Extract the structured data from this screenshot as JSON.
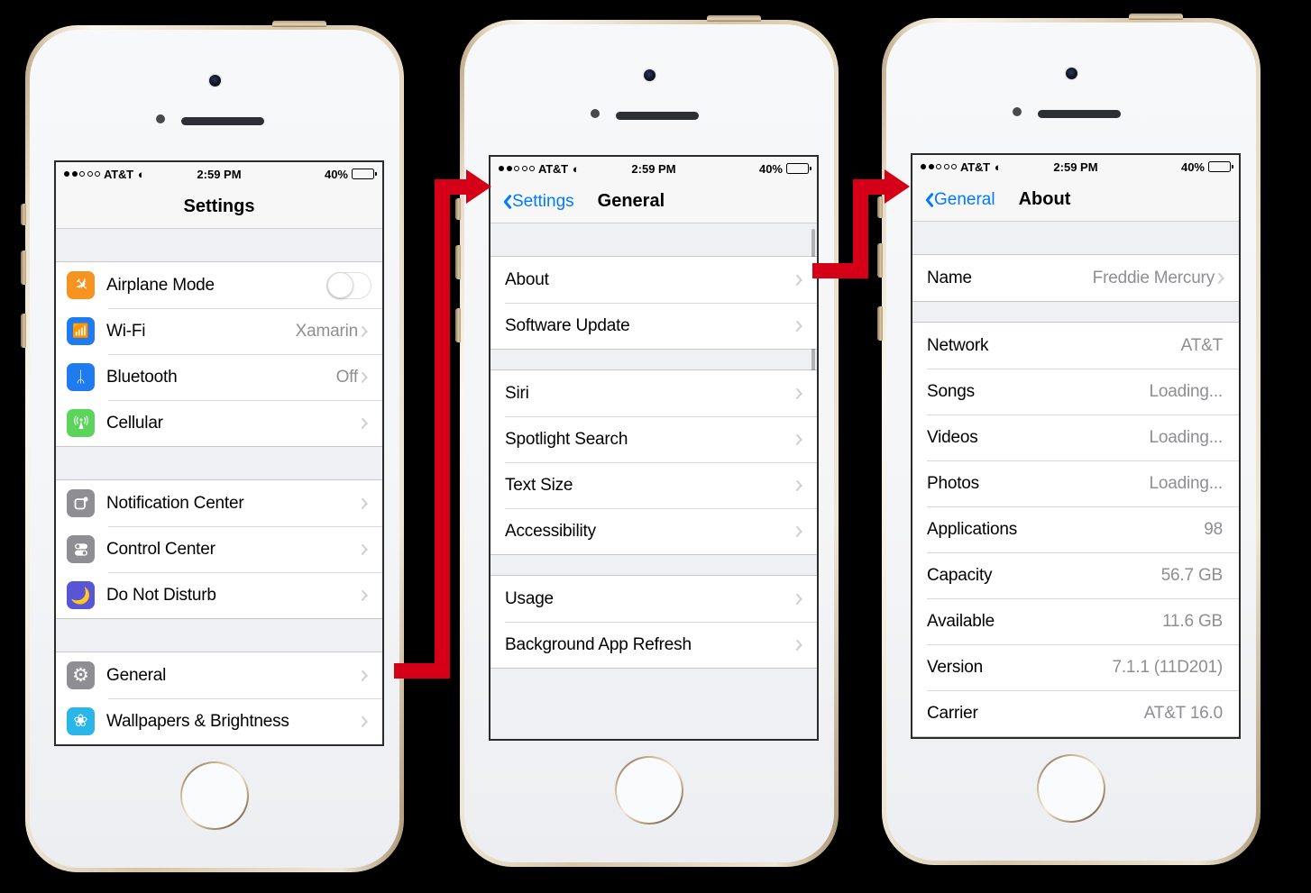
{
  "background_color": "#000000",
  "accent_color": "#007aff",
  "arrow_color": "#d50017",
  "statusbar": {
    "carrier": "AT&T",
    "time": "2:59 PM",
    "battery_percent": "40%",
    "signal_dots_filled": 2,
    "signal_dots_total": 5,
    "wifi_icon": "wifi-icon",
    "battery_icon": "battery-icon"
  },
  "phones": [
    {
      "id": "phone-settings",
      "nav": {
        "title": "Settings",
        "back_label": null,
        "centered": true
      },
      "sections": [
        {
          "rows": [
            {
              "label": "Airplane Mode",
              "icon": "airplane-icon",
              "icon_color": "#f79421",
              "glyph": "g-plane",
              "accessory": "toggle",
              "toggle_on": false
            },
            {
              "label": "Wi-Fi",
              "icon": "wifi-settings-icon",
              "icon_color": "#1f7bf0",
              "glyph": "g-wifi",
              "value": "Xamarin",
              "accessory": "chevron"
            },
            {
              "label": "Bluetooth",
              "icon": "bluetooth-icon",
              "icon_color": "#1f7bf0",
              "glyph": "g-bt",
              "value": "Off",
              "accessory": "chevron"
            },
            {
              "label": "Cellular",
              "icon": "cellular-icon",
              "icon_color": "#5ad45a",
              "glyph": "g-cell",
              "value": "",
              "accessory": "chevron"
            }
          ]
        },
        {
          "rows": [
            {
              "label": "Notification Center",
              "icon": "notification-center-icon",
              "icon_color": "#8e8e93",
              "glyph": "g-notif",
              "value": "",
              "accessory": "chevron"
            },
            {
              "label": "Control Center",
              "icon": "control-center-icon",
              "icon_color": "#8e8e93",
              "glyph": "g-control",
              "value": "",
              "accessory": "chevron"
            },
            {
              "label": "Do Not Disturb",
              "icon": "do-not-disturb-icon",
              "icon_color": "#5956d6",
              "glyph": "g-moon",
              "value": "",
              "accessory": "chevron"
            }
          ]
        },
        {
          "rows": [
            {
              "label": "General",
              "icon": "general-gear-icon",
              "icon_color": "#8e8e93",
              "glyph": "g-gear",
              "value": "",
              "accessory": "chevron"
            },
            {
              "label": "Wallpapers & Brightness",
              "icon": "wallpapers-icon",
              "icon_color": "#2ab6e8",
              "glyph": "g-flower",
              "value": "",
              "accessory": "chevron"
            }
          ]
        }
      ]
    },
    {
      "id": "phone-general",
      "nav": {
        "title": "General",
        "back_label": "Settings",
        "centered": false
      },
      "has_scrollbar": true,
      "sections": [
        {
          "rows": [
            {
              "label": "About",
              "value": "",
              "accessory": "chevron"
            },
            {
              "label": "Software Update",
              "value": "",
              "accessory": "chevron"
            }
          ]
        },
        {
          "rows": [
            {
              "label": "Siri",
              "value": "",
              "accessory": "chevron"
            },
            {
              "label": "Spotlight Search",
              "value": "",
              "accessory": "chevron"
            },
            {
              "label": "Text Size",
              "value": "",
              "accessory": "chevron"
            },
            {
              "label": "Accessibility",
              "value": "",
              "accessory": "chevron"
            }
          ]
        },
        {
          "rows": [
            {
              "label": "Usage",
              "value": "",
              "accessory": "chevron"
            },
            {
              "label": "Background App Refresh",
              "value": "",
              "accessory": "chevron"
            }
          ]
        }
      ]
    },
    {
      "id": "phone-about",
      "nav": {
        "title": "About",
        "back_label": "General",
        "centered": false
      },
      "sections": [
        {
          "rows": [
            {
              "label": "Name",
              "value": "Freddie Mercury",
              "accessory": "chevron"
            }
          ]
        },
        {
          "rows": [
            {
              "label": "Network",
              "value": "AT&T",
              "accessory": "none"
            },
            {
              "label": "Songs",
              "value": "Loading...",
              "accessory": "none"
            },
            {
              "label": "Videos",
              "value": "Loading...",
              "accessory": "none"
            },
            {
              "label": "Photos",
              "value": "Loading...",
              "accessory": "none"
            },
            {
              "label": "Applications",
              "value": "98",
              "accessory": "none"
            },
            {
              "label": "Capacity",
              "value": "56.7 GB",
              "accessory": "none"
            },
            {
              "label": "Available",
              "value": "11.6 GB",
              "accessory": "none"
            },
            {
              "label": "Version",
              "value": "7.1.1 (11D201)",
              "accessory": "none"
            },
            {
              "label": "Carrier",
              "value": "AT&T 16.0",
              "accessory": "none"
            }
          ]
        }
      ]
    }
  ],
  "arrows": [
    {
      "name": "arrow-general-to-general-screen",
      "from": "General row (Settings)",
      "to": "General screen back button"
    },
    {
      "name": "arrow-about-to-about-screen",
      "from": "About row (General)",
      "to": "About screen back button"
    }
  ]
}
